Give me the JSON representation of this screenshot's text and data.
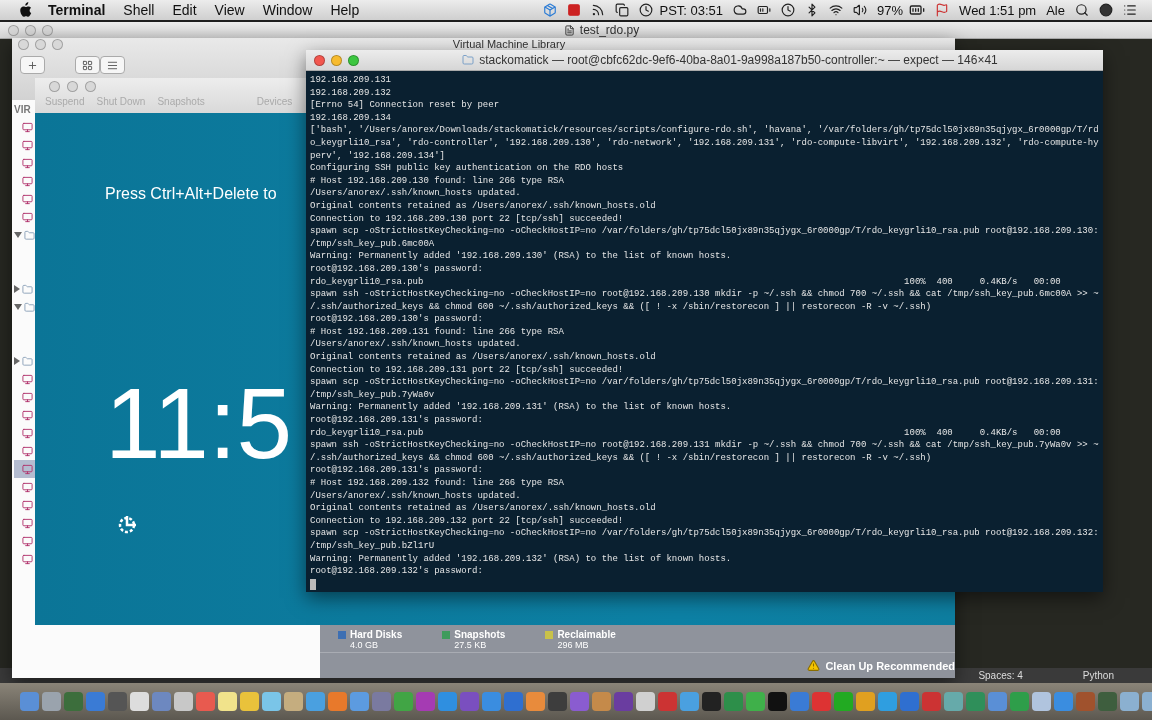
{
  "menu_bar": {
    "app": "Terminal",
    "menus": [
      "Shell",
      "Edit",
      "View",
      "Window",
      "Help"
    ],
    "world_clock": "PST: 03:51",
    "battery": "97%",
    "datetime": "Wed 1:51 pm",
    "user": "Ale"
  },
  "editor": {
    "title": "test_rdo.py",
    "status_bar": {
      "indent": "Spaces: 4",
      "syntax": "Python"
    }
  },
  "library": {
    "title": "Virtual Machine Library",
    "sidebar": {
      "heading": "VIR",
      "items": [
        {
          "kind": "vm",
          "selected": false
        },
        {
          "kind": "vm",
          "selected": false
        },
        {
          "kind": "vm",
          "selected": false
        },
        {
          "kind": "vm",
          "selected": false
        },
        {
          "kind": "vm",
          "selected": false
        },
        {
          "kind": "vm",
          "selected": false
        },
        {
          "kind": "folder",
          "expanded": true
        },
        {
          "kind": "folder",
          "expanded": false
        },
        {
          "kind": "folder",
          "expanded": true
        },
        {
          "kind": "folder",
          "expanded": false
        },
        {
          "kind": "vm",
          "selected": false
        },
        {
          "kind": "vm",
          "selected": false
        },
        {
          "kind": "vm",
          "selected": false
        },
        {
          "kind": "vm",
          "selected": false
        },
        {
          "kind": "vm",
          "selected": false
        },
        {
          "kind": "vm",
          "selected": true
        },
        {
          "kind": "vm",
          "selected": false
        },
        {
          "kind": "vm",
          "selected": false
        },
        {
          "kind": "vm",
          "selected": false
        },
        {
          "kind": "vm",
          "selected": false
        },
        {
          "kind": "vm",
          "selected": false
        }
      ]
    },
    "storage": [
      {
        "label": "Hard Disks",
        "size": "4.0 GB",
        "color": "#3d6fb3"
      },
      {
        "label": "Snapshots",
        "size": "27.5 KB",
        "color": "#3f9b5c"
      },
      {
        "label": "Reclaimable",
        "size": "296 MB",
        "color": "#c9c24a"
      }
    ],
    "cleanup": "Clean Up Recommended"
  },
  "vm": {
    "toolbar": [
      "Suspend",
      "Shut Down",
      "Snapshots",
      "Devices"
    ],
    "lock_message": "Press Ctrl+Alt+Delete to",
    "clock": "11:5"
  },
  "terminal": {
    "title": "stackomatick — root@cbfc62dc-9ef6-40ba-8a01-9a998a187b50-controller:~ — expect — 146×41",
    "lines": [
      "192.168.209.131",
      "192.168.209.132",
      "[Errno 54] Connection reset by peer",
      "192.168.209.134",
      "['bash', '/Users/anorex/Downloads/stackomatick/resources/scripts/configure-rdo.sh', 'havana', '/var/folders/gh/tp75dcl50jx89n35qjygx_6r0000gp/T/rd",
      "o_keygrli10_rsa', 'rdo-controller', '192.168.209.130', 'rdo-network', '192.168.209.131', 'rdo-compute-libvirt', '192.168.209.132', 'rdo-compute-hy",
      "perv', '192.168.209.134']",
      "Configuring SSH public key authentication on the RDO hosts",
      "# Host 192.168.209.130 found: line 266 type RSA",
      "/Users/anorex/.ssh/known_hosts updated.",
      "Original contents retained as /Users/anorex/.ssh/known_hosts.old",
      "Connection to 192.168.209.130 port 22 [tcp/ssh] succeeded!",
      "spawn scp -oStrictHostKeyChecking=no -oCheckHostIP=no /var/folders/gh/tp75dcl50jx89n35qjygx_6r0000gp/T/rdo_keygrli10_rsa.pub root@192.168.209.130:",
      "/tmp/ssh_key_pub.6mc00A",
      "Warning: Permanently added '192.168.209.130' (RSA) to the list of known hosts.",
      "root@192.168.209.130's password:",
      "rdo_keygrli10_rsa.pub                                                                                         100%  400     0.4KB/s   00:00",
      "spawn ssh -oStrictHostKeyChecking=no -oCheckHostIP=no root@192.168.209.130 mkdir -p ~/.ssh && chmod 700 ~/.ssh && cat /tmp/ssh_key_pub.6mc00A >> ~",
      "/.ssh/authorized_keys && chmod 600 ~/.ssh/authorized_keys && ([ ! -x /sbin/restorecon ] || restorecon -R -v ~/.ssh)",
      "root@192.168.209.130's password:",
      "# Host 192.168.209.131 found: line 266 type RSA",
      "/Users/anorex/.ssh/known_hosts updated.",
      "Original contents retained as /Users/anorex/.ssh/known_hosts.old",
      "Connection to 192.168.209.131 port 22 [tcp/ssh] succeeded!",
      "spawn scp -oStrictHostKeyChecking=no -oCheckHostIP=no /var/folders/gh/tp75dcl50jx89n35qjygx_6r0000gp/T/rdo_keygrli10_rsa.pub root@192.168.209.131:",
      "/tmp/ssh_key_pub.7yWa0v",
      "Warning: Permanently added '192.168.209.131' (RSA) to the list of known hosts.",
      "root@192.168.209.131's password:",
      "rdo_keygrli10_rsa.pub                                                                                         100%  400     0.4KB/s   00:00",
      "spawn ssh -oStrictHostKeyChecking=no -oCheckHostIP=no root@192.168.209.131 mkdir -p ~/.ssh && chmod 700 ~/.ssh && cat /tmp/ssh_key_pub.7yWa0v >> ~",
      "/.ssh/authorized_keys && chmod 600 ~/.ssh/authorized_keys && ([ ! -x /sbin/restorecon ] || restorecon -R -v ~/.ssh)",
      "root@192.168.209.131's password:",
      "# Host 192.168.209.132 found: line 266 type RSA",
      "/Users/anorex/.ssh/known_hosts updated.",
      "Original contents retained as /Users/anorex/.ssh/known_hosts.old",
      "Connection to 192.168.209.132 port 22 [tcp/ssh] succeeded!",
      "spawn scp -oStrictHostKeyChecking=no -oCheckHostIP=no /var/folders/gh/tp75dcl50jx89n35qjygx_6r0000gp/T/rdo_keygrli10_rsa.pub root@192.168.209.132:",
      "/tmp/ssh_key_pub.bZl1rU",
      "Warning: Permanently added '192.168.209.132' (RSA) to the list of known hosts.",
      "root@192.168.209.132's password:"
    ]
  }
}
